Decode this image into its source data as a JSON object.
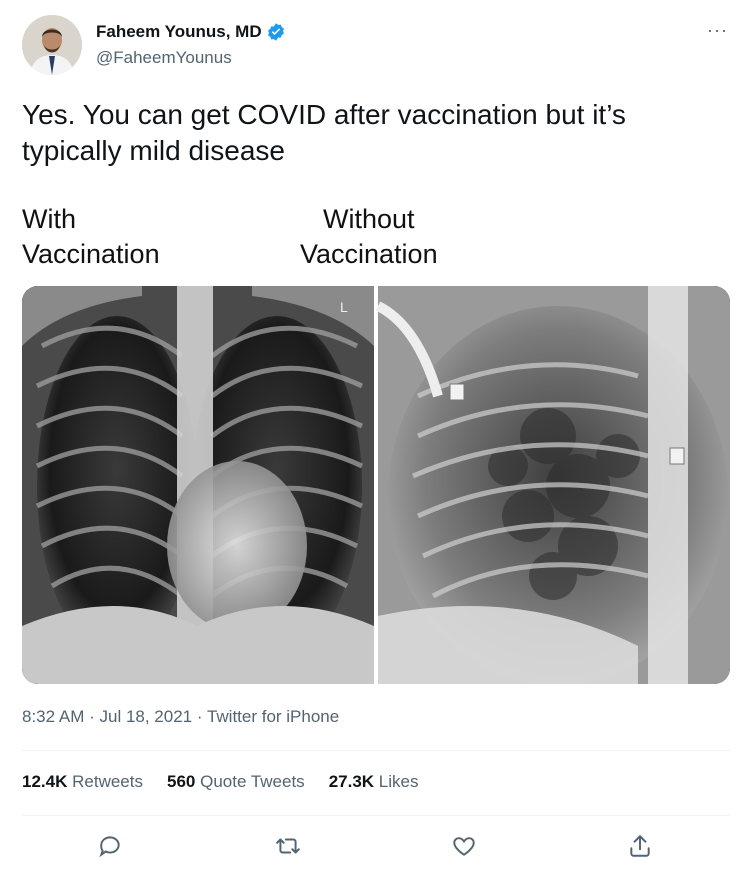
{
  "author": {
    "name": "Faheem Younus, MD",
    "handle": "@FaheemYounus",
    "verified": true,
    "more_glyph": "···"
  },
  "tweet": {
    "text": "Yes. You can get COVID after vaccination but it’s typically mild disease"
  },
  "media": {
    "left_caption_line1": "With",
    "left_caption_line2": "Vaccination",
    "right_caption_line1": "Without",
    "right_caption_line2": "Vaccination",
    "xray_marker": "L"
  },
  "meta": {
    "time": "8:32 AM",
    "sep1": " · ",
    "date": "Jul 18, 2021",
    "sep2": " · ",
    "source": "Twitter for iPhone"
  },
  "stats": {
    "retweets_count": "12.4K",
    "retweets_label": "Retweets",
    "quotes_count": "560",
    "quotes_label": "Quote Tweets",
    "likes_count": "27.3K",
    "likes_label": "Likes"
  },
  "icons": {
    "reply": "reply-icon",
    "retweet": "retweet-icon",
    "like": "heart-icon",
    "share": "share-icon"
  },
  "colors": {
    "verified_blue": "#1d9bf0",
    "text": "#0f1419",
    "secondary": "#536471"
  }
}
